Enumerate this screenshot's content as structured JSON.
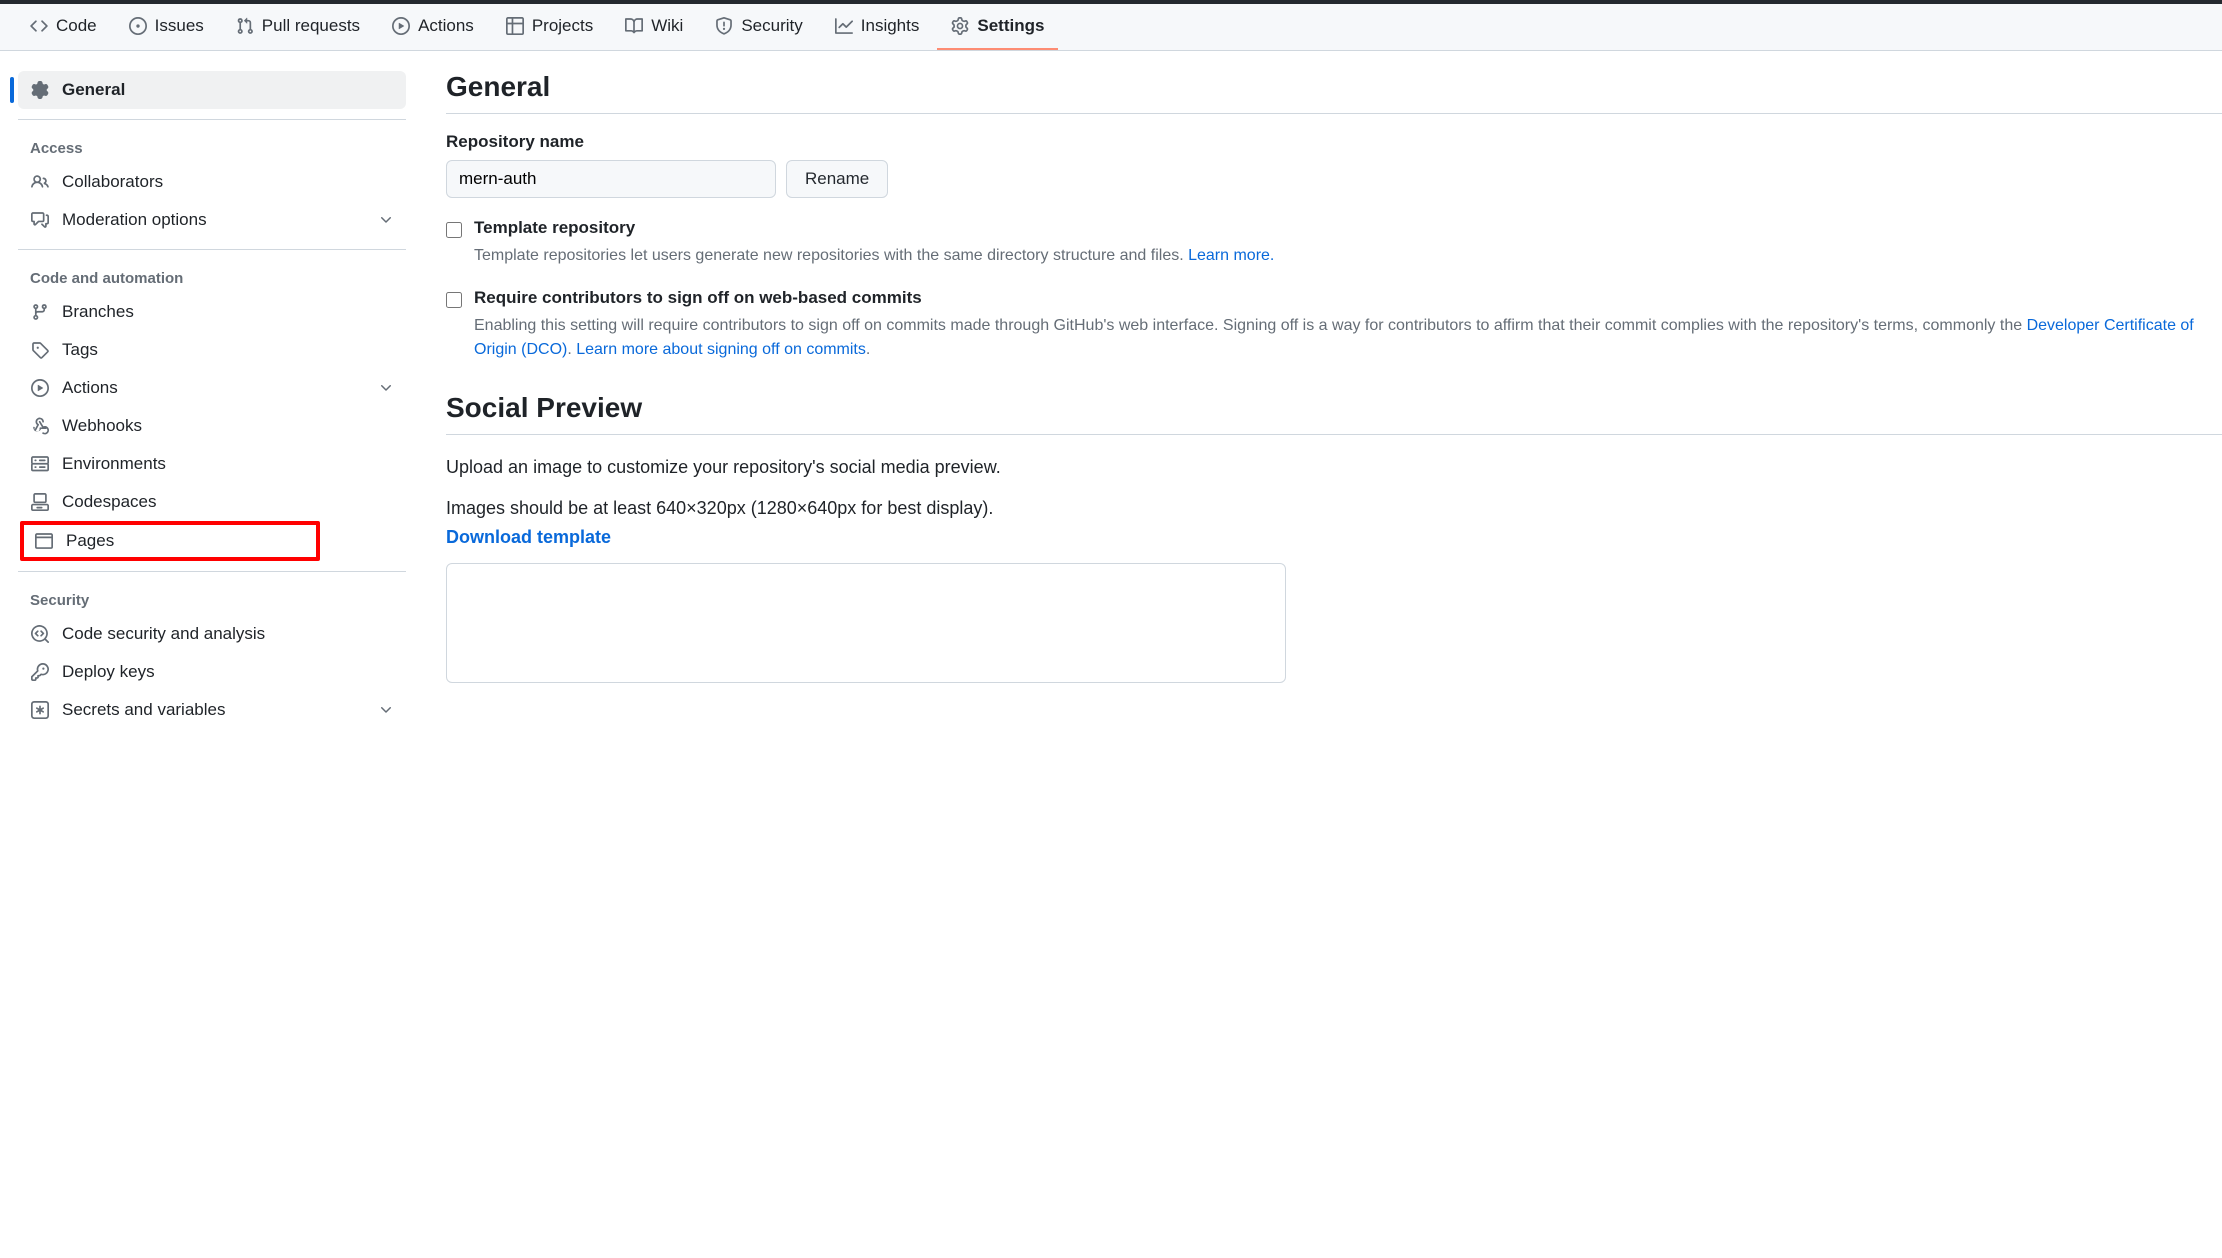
{
  "tabs": {
    "code": "Code",
    "issues": "Issues",
    "pull_requests": "Pull requests",
    "actions": "Actions",
    "projects": "Projects",
    "wiki": "Wiki",
    "security": "Security",
    "insights": "Insights",
    "settings": "Settings"
  },
  "sidebar": {
    "general": "General",
    "access_heading": "Access",
    "collaborators": "Collaborators",
    "moderation": "Moderation options",
    "code_heading": "Code and automation",
    "branches": "Branches",
    "tags": "Tags",
    "actions": "Actions",
    "webhooks": "Webhooks",
    "environments": "Environments",
    "codespaces": "Codespaces",
    "pages": "Pages",
    "security_heading": "Security",
    "code_security": "Code security and analysis",
    "deploy_keys": "Deploy keys",
    "secrets": "Secrets and variables"
  },
  "main": {
    "general_title": "General",
    "repo_name_label": "Repository name",
    "repo_name_value": "mern-auth",
    "rename_button": "Rename",
    "template_label": "Template repository",
    "template_desc": "Template repositories let users generate new repositories with the same directory structure and files. ",
    "learn_more": "Learn more.",
    "signoff_label": "Require contributors to sign off on web-based commits",
    "signoff_desc_1": "Enabling this setting will require contributors to sign off on commits made through GitHub's web interface. Signing off is a way for contributors to affirm that their commit complies with the repository's terms, commonly the ",
    "dco_link": "Developer Certificate of Origin (DCO)",
    "signoff_desc_2": ". ",
    "signoff_learn": "Learn more about signing off on commits",
    "signoff_period": ".",
    "social_title": "Social Preview",
    "social_line1": "Upload an image to customize your repository's social media preview.",
    "social_line2": "Images should be at least 640×320px (1280×640px for best display).",
    "download_template": "Download template"
  }
}
